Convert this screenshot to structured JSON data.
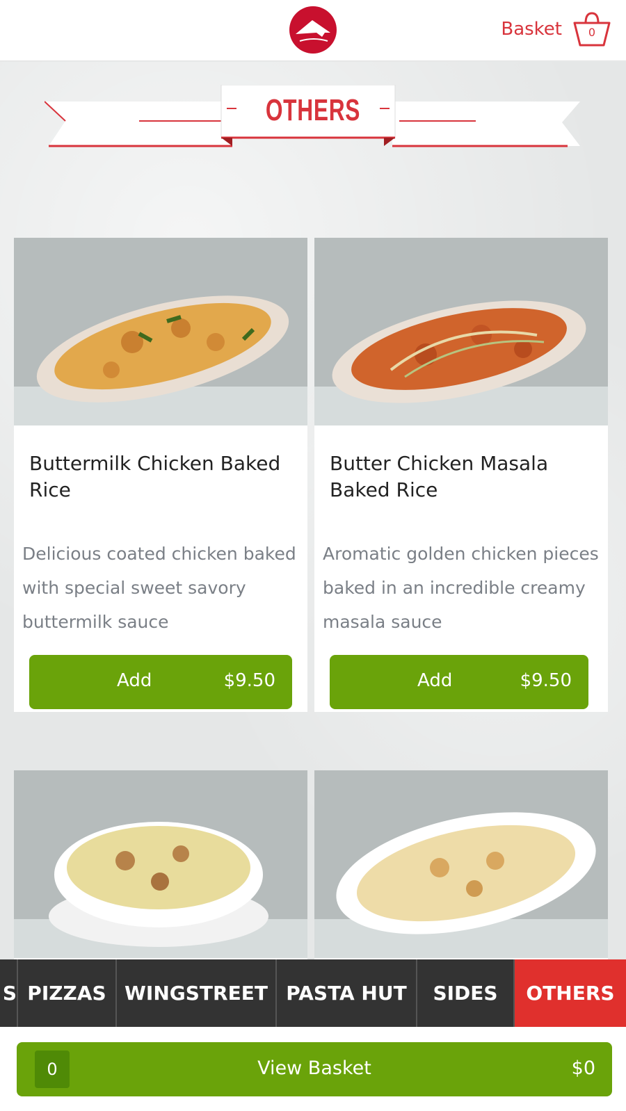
{
  "header": {
    "logo": "pizza-hut-logo",
    "basket_label": "Basket",
    "basket_count": "0"
  },
  "section": {
    "title": "OTHERS"
  },
  "products": [
    {
      "name": "Buttermilk Chicken Baked Rice",
      "description": "Delicious coated chicken baked with special sweet savory buttermilk sauce",
      "add_label": "Add",
      "price": "$9.50"
    },
    {
      "name": "Butter Chicken Masala Baked Rice",
      "description": "Aromatic golden chicken pieces baked in an incredible creamy masala sauce",
      "add_label": "Add",
      "price": "$9.50"
    },
    {
      "name": "",
      "description": ""
    },
    {
      "name": "",
      "description": ""
    }
  ],
  "categories": [
    {
      "label": "S",
      "active": false
    },
    {
      "label": "PIZZAS",
      "active": false
    },
    {
      "label": "WINGSTREET",
      "active": false
    },
    {
      "label": "PASTA HUT",
      "active": false
    },
    {
      "label": "SIDES",
      "active": false
    },
    {
      "label": "OTHERS",
      "active": true
    }
  ],
  "footer": {
    "count": "0",
    "view_label": "View Basket",
    "total": "$0"
  },
  "colors": {
    "brand_red": "#d8343c",
    "active_tab": "#e0302d",
    "green": "#6aa30a",
    "tab_bar": "#333333"
  }
}
